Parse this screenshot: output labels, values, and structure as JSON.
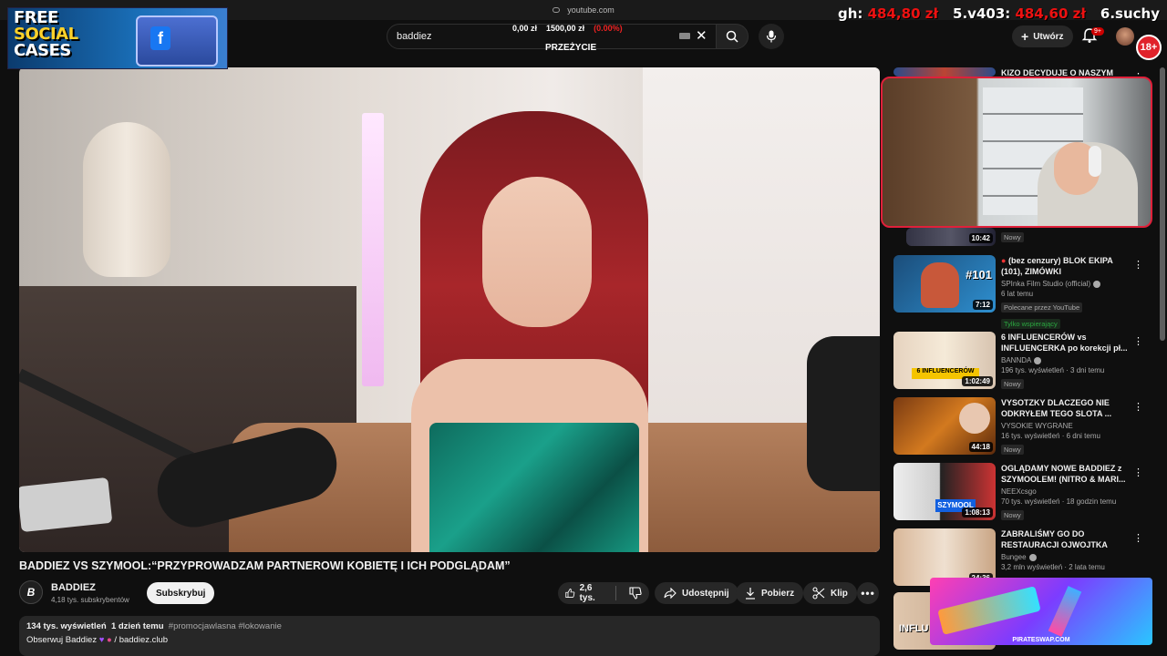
{
  "browser": {
    "url": "youtube.com"
  },
  "overlay": {
    "ad_top_line1": "FREE",
    "ad_top_line2": "SOCIAL",
    "ad_top_line3": "CASES",
    "ad_bottom_label": "PIRATESWAP.COM",
    "ticker_gh_label": "gh:",
    "ticker_gh_value": "484,80 zł",
    "ticker_v403_label": "5.v403:",
    "ticker_v403_value": "484,60 zł",
    "ticker_suchy_label": "6.suchy",
    "stats_left": "0,00 zł",
    "stats_mid": "1500,00 zł",
    "stats_right": "(0.00%)",
    "stats_sub": "PRZEŻYCIE",
    "age_badge": "18+"
  },
  "header": {
    "search_value": "baddiez",
    "create_label": "Utwórz",
    "notif_count": "9+"
  },
  "video": {
    "title": "BADDIEZ VS SZYMOOL:“PRZYPROWADZAM PARTNEROWI KOBIETĘ I ICH PODGLĄDAM”",
    "channel_name": "BADDIEZ",
    "channel_subs": "4,18 tys. subskrybentów",
    "subscribe_label": "Subskrybuj",
    "likes": "2,6 tys.",
    "share_label": "Udostępnij",
    "download_label": "Pobierz",
    "clip_label": "Klip",
    "views": "134 tys. wyświetleń",
    "age": "1 dzień temu",
    "tags": "#promocjawlasna #lokowanie",
    "desc_line2_a": "Obserwuj Baddiez",
    "desc_line2_b": "/ baddiez.club"
  },
  "sidebar": {
    "top_partial_title": "KIZO DECYDUJE O NASZYM",
    "partial_duration": "10:42",
    "partial_badge": "Nowy",
    "items": [
      {
        "title": "(bez cenzury) BLOK EKIPA (101), ZIMÓWKI",
        "channel": "SPInka Film Studio (official)",
        "stats": "6 lat temu",
        "badge1": "Polecane przez YouTube",
        "badge2": "Tylko wspierający",
        "duration": "7:12"
      },
      {
        "title": "6 INFLUENCERÓW vs INFLUENCERKA po korekcji pł...",
        "channel": "BANNDA",
        "stats": "196 tys. wyświetleń · 3 dni temu",
        "badge1": "Nowy",
        "duration": "1:02:49"
      },
      {
        "title": "VYSOTZKY DLACZEGO NIE ODKRYŁEM TEGO SLOTA ...",
        "channel": "VYSOKIE WYGRANE",
        "stats": "16 tys. wyświetleń · 6 dni temu",
        "badge1": "Nowy",
        "duration": "44:18"
      },
      {
        "title": "OGLĄDAMY NOWE BADDIEZ z SZYMOOLEM! (NITRO & MARI...",
        "channel": "NEEXcsgo",
        "stats": "70 tys. wyświetleń · 18 godzin temu",
        "badge1": "Nowy",
        "duration": "1:08:13"
      },
      {
        "title": "ZABRALIŚMY GO DO RESTAURACJI OJWOJTKA",
        "channel": "Bungee",
        "stats": "3,2 mln wyświetleń · 2 lata temu",
        "duration": "24:36"
      }
    ]
  },
  "colors": {
    "bg": "#0f0f0f",
    "pill": "#272727",
    "accent_red": "#cc0000"
  }
}
